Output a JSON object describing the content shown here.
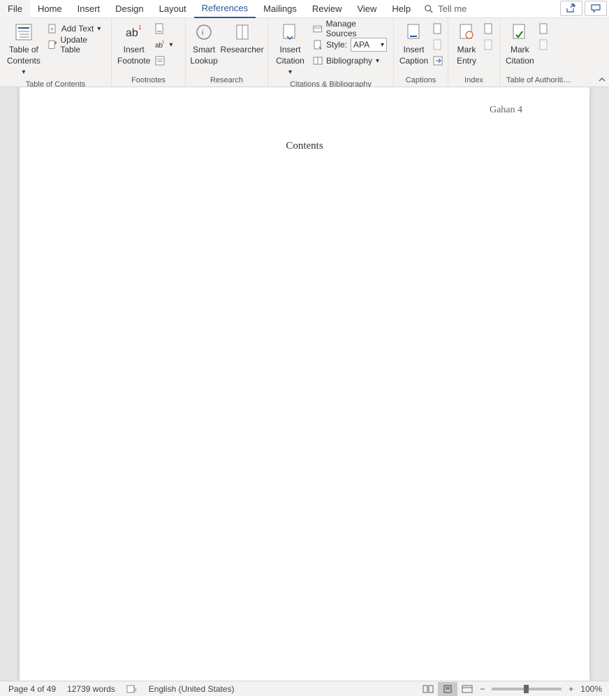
{
  "tabs": {
    "file": "File",
    "home": "Home",
    "insert": "Insert",
    "design": "Design",
    "layout": "Layout",
    "references": "References",
    "mailings": "Mailings",
    "review": "Review",
    "view": "View",
    "help": "Help",
    "tellme": "Tell me"
  },
  "ribbon": {
    "toc": {
      "label": "Table of Contents",
      "button": "Table of\nContents",
      "add_text": "Add Text",
      "update_table": "Update Table"
    },
    "footnotes": {
      "label": "Footnotes",
      "insert": "Insert\nFootnote"
    },
    "research": {
      "label": "Research",
      "smart": "Smart\nLookup",
      "researcher": "Researcher"
    },
    "citations": {
      "label": "Citations & Bibliography",
      "insert": "Insert\nCitation",
      "manage": "Manage Sources",
      "style_label": "Style:",
      "style_value": "APA",
      "bibliography": "Bibliography"
    },
    "captions": {
      "label": "Captions",
      "insert": "Insert\nCaption"
    },
    "index": {
      "label": "Index",
      "mark": "Mark\nEntry"
    },
    "toa": {
      "label": "Table of Authoriti…",
      "mark": "Mark\nCitation"
    }
  },
  "document": {
    "header": "Gahan 4",
    "title": "Contents"
  },
  "status": {
    "page": "Page 4 of 49",
    "words": "12739 words",
    "language": "English (United States)",
    "zoom": "100%"
  }
}
